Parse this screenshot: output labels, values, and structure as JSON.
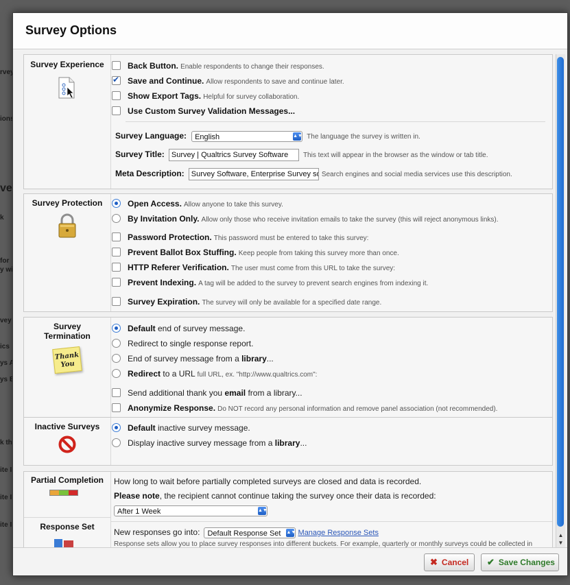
{
  "background": {
    "fragments": [
      "rvey",
      "ions",
      "ve",
      "k",
      "for",
      "y wi",
      "vey",
      "ics",
      "ys A",
      "ys B",
      "k th",
      "ite I",
      "ite I",
      "ite I"
    ]
  },
  "dialog": {
    "title": "Survey Options"
  },
  "experience": {
    "title": "Survey Experience",
    "options": [
      {
        "label": "Back Button.",
        "desc": "Enable respondents to change their responses.",
        "checked": false
      },
      {
        "label": "Save and Continue.",
        "desc": "Allow respondents to save and continue later.",
        "checked": true
      },
      {
        "label": "Show Export Tags.",
        "desc": "Helpful for survey collaboration.",
        "checked": false
      },
      {
        "label": "Use Custom Survey Validation Messages...",
        "desc": "",
        "checked": false
      }
    ],
    "language": {
      "label": "Survey Language:",
      "value": "English",
      "desc": "The language the survey is written in."
    },
    "survey_title": {
      "label": "Survey Title:",
      "value": "Survey | Qualtrics Survey Software",
      "desc": "This text will appear in the browser as the window or tab title."
    },
    "meta": {
      "label": "Meta Description:",
      "value": "Survey Software, Enterprise Survey softw",
      "desc": "Search engines and social media services use this description."
    }
  },
  "protection": {
    "title": "Survey Protection",
    "radios": [
      {
        "label": "Open Access.",
        "desc": "Allow anyone to take this survey.",
        "checked": true
      },
      {
        "label": "By Invitation Only.",
        "desc": "Allow only those who receive invitation emails to take the survey (this will reject anonymous links).",
        "checked": false
      }
    ],
    "checks": [
      {
        "label": "Password Protection.",
        "desc": "This password must be entered to take this survey:"
      },
      {
        "label": "Prevent Ballot Box Stuffing.",
        "desc": "Keep people from taking this survey more than once."
      },
      {
        "label": "HTTP Referer Verification.",
        "desc": "The user must come from this URL to take the survey:"
      },
      {
        "label": "Prevent Indexing.",
        "desc": "A tag will be added to the survey to prevent search engines from indexing it."
      },
      {
        "label": "Survey Expiration.",
        "desc": "The survey will only be available for a specified date range."
      }
    ]
  },
  "termination": {
    "title_line1": "Survey",
    "title_line2": "Termination",
    "icon_text_1": "Thank",
    "icon_text_2": "You",
    "radios": [
      {
        "bold": "Default",
        "rest": " end of survey message.",
        "checked": true
      },
      {
        "bold": "",
        "rest": "Redirect to single response report.",
        "checked": false
      },
      {
        "pre": "End of survey message from a ",
        "bold": "library",
        "rest": "...",
        "checked": false
      },
      {
        "bold": "Redirect",
        "rest": " to a URL",
        "desc": " full URL, ex. \"http://www.qualtrics.com\":",
        "checked": false
      }
    ],
    "email": {
      "pre": "Send additional thank you ",
      "bold": "email",
      "rest": " from a library..."
    },
    "anonymize": {
      "label": "Anonymize Response.",
      "desc": "Do NOT record any personal information and remove panel association (not recommended)."
    }
  },
  "inactive": {
    "title": "Inactive Surveys",
    "radios": [
      {
        "bold": "Default",
        "rest": " inactive survey message.",
        "checked": true
      },
      {
        "pre": "Display inactive survey message from a ",
        "bold": "library",
        "rest": "...",
        "checked": false
      }
    ]
  },
  "partial": {
    "title": "Partial Completion",
    "line1": "How long to wait before partially completed surveys are closed and data is recorded.",
    "note_bold": "Please note",
    "note_rest": ", the recipient cannot continue taking the survey once their data is recorded:",
    "select": "After 1 Week"
  },
  "response_set": {
    "title": "Response Set",
    "label": "New responses go into:",
    "select": "Default Response Set",
    "link": "Manage Response Sets",
    "desc": "Response sets allow you to place survey responses into different buckets. For example, quarterly or monthly surveys could be collected in"
  },
  "footer": {
    "cancel": "Cancel",
    "save": "Save Changes"
  }
}
